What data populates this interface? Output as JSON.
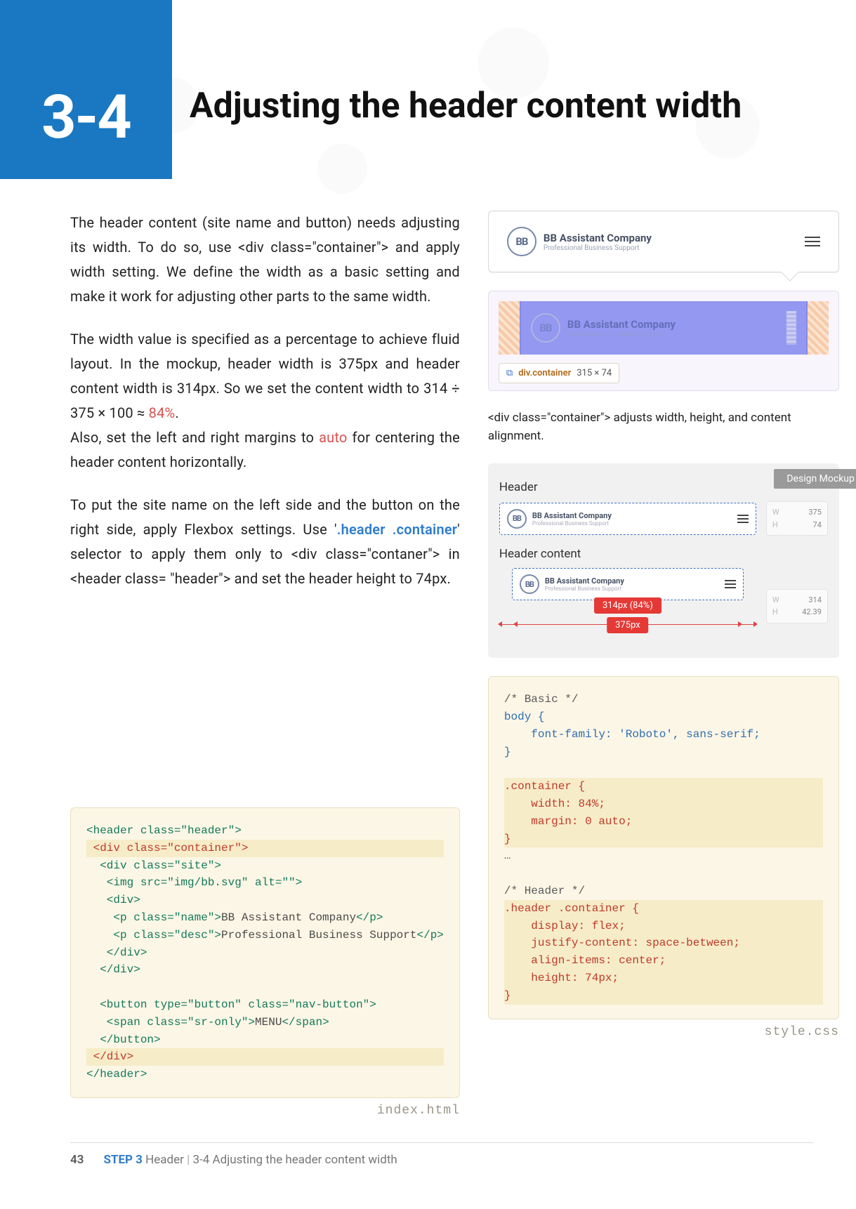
{
  "chapter_badge": "3-4",
  "title": "Adjusting the header content width",
  "paragraphs": {
    "p1": "The header content (site name and button) needs adjusting its width. To do so, use <div class=\"container\"> and apply width setting. We define the width as a basic setting and make it work for adjusting other parts to the same width.",
    "p2a": "The width value is specified as a percentage to achieve fluid layout. In the mockup, header width is 375px and header content width is 314px. So we set the content width to 314 ÷ 375 × 100 ≈ ",
    "p2_pct": "84%",
    "p2b": ".",
    "p3a": "Also, set the left and right margins to ",
    "p3_auto": "auto",
    "p3b": " for centering the header content horizontally.",
    "p4a": "To put the site name on the left side and the button on the right side, apply Flexbox settings. Use '",
    "p4_sel": ".header .container",
    "p4b": "' selector to apply them only to <div class=\"contaner\"> in <header class= \"header\"> and set the header height to 74px."
  },
  "illus": {
    "company_name": "BB Assistant Company",
    "company_desc": "Professional Business Support",
    "devtool_chip_sel": "div.container",
    "devtool_chip_dims": "315 × 74",
    "caption": "<div class=\"container\"> adjusts width, height, and content alignment.",
    "mockup_tag": "Design Mockup",
    "label_header": "Header",
    "label_header_content": "Header content",
    "dims_header_w": "375",
    "dims_header_h": "74",
    "dims_content_w": "314",
    "dims_content_h": "42.39",
    "measure_inner": "314px (84%)",
    "measure_outer": "375px"
  },
  "code_html": {
    "filename": "index.html",
    "lines": [
      {
        "t": "<header class=\"header\">",
        "cls": "tag",
        "i": 0
      },
      {
        "t": " <div class=\"container\">",
        "cls": "red",
        "i": 0,
        "hl": true
      },
      {
        "t": "  <div class=\"site\">",
        "cls": "tag",
        "i": 0
      },
      {
        "t": "   <img src=\"img/bb.svg\" alt=\"\">",
        "cls": "tag",
        "i": 0
      },
      {
        "t": "   <div>",
        "cls": "tag",
        "i": 0
      },
      {
        "t": "    <p class=\"name\">BB Assistant Company</p>",
        "cls": "mixed",
        "i": 0
      },
      {
        "t": "    <p class=\"desc\">Professional Business Support</p>",
        "cls": "mixed",
        "i": 0
      },
      {
        "t": "   </div>",
        "cls": "tag",
        "i": 0
      },
      {
        "t": "  </div>",
        "cls": "tag",
        "i": 0
      },
      {
        "t": "",
        "cls": "",
        "i": 0
      },
      {
        "t": "  <button type=\"button\" class=\"nav-button\">",
        "cls": "tag",
        "i": 0
      },
      {
        "t": "   <span class=\"sr-only\">MENU</span>",
        "cls": "mixed",
        "i": 0
      },
      {
        "t": "  </button>",
        "cls": "tag",
        "i": 0
      },
      {
        "t": " </div>",
        "cls": "red",
        "i": 0,
        "hl": true
      },
      {
        "t": "</header>",
        "cls": "tag",
        "i": 0
      }
    ]
  },
  "code_css": {
    "filename": "style.css",
    "lines": [
      {
        "t": "/* Basic */",
        "cls": "comment"
      },
      {
        "t": "body {",
        "cls": "sel"
      },
      {
        "t": "    font-family: 'Roboto', sans-serif;",
        "cls": "prop"
      },
      {
        "t": "}",
        "cls": "sel"
      },
      {
        "t": "",
        "cls": ""
      },
      {
        "t": ".container {",
        "cls": "red",
        "hl": true
      },
      {
        "t": "    width: 84%;",
        "cls": "red",
        "hl": true
      },
      {
        "t": "    margin: 0 auto;",
        "cls": "red",
        "hl": true
      },
      {
        "t": "}",
        "cls": "red",
        "hl": true
      },
      {
        "t": "…",
        "cls": "comment"
      },
      {
        "t": "",
        "cls": ""
      },
      {
        "t": "/* Header */",
        "cls": "comment"
      },
      {
        "t": ".header .container {",
        "cls": "red",
        "hl": true
      },
      {
        "t": "    display: flex;",
        "cls": "red",
        "hl": true
      },
      {
        "t": "    justify-content: space-between;",
        "cls": "red",
        "hl": true
      },
      {
        "t": "    align-items: center;",
        "cls": "red",
        "hl": true
      },
      {
        "t": "    height: 74px;",
        "cls": "red",
        "hl": true
      },
      {
        "t": "}",
        "cls": "red",
        "hl": true
      }
    ]
  },
  "footer": {
    "page_number": "43",
    "step_label": "STEP 3",
    "step_name": "Header",
    "section": "3-4 Adjusting the header content width"
  }
}
